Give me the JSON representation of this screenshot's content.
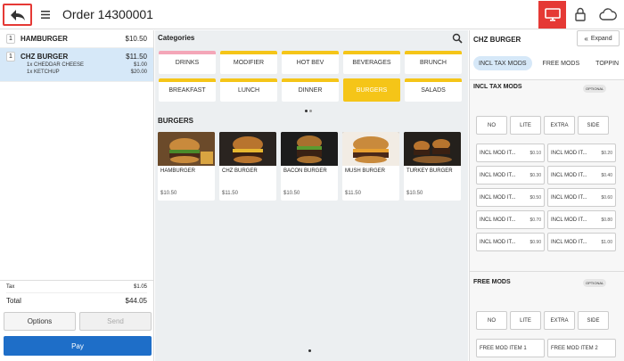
{
  "header": {
    "order_title": "Order 14300001"
  },
  "ticket": {
    "items": [
      {
        "qty": "1",
        "name": "HAMBURGER",
        "price": "$10.50",
        "mods": []
      },
      {
        "qty": "1",
        "name": "CHZ BURGER",
        "price": "$11.50",
        "mods": [
          {
            "name": "1x  CHEDDAR CHEESE",
            "price": "$1.00"
          },
          {
            "name": "1x  KETCHUP",
            "price": "$20.00"
          }
        ]
      }
    ],
    "tax_label": "Tax",
    "tax_value": "$1.05",
    "total_label": "Total",
    "total_value": "$44.05",
    "options_label": "Options",
    "send_label": "Send",
    "pay_label": "Pay"
  },
  "categories": {
    "title": "Categories",
    "items": [
      "DRINKS",
      "MODIFIER",
      "HOT BEV",
      "BEVERAGES",
      "BRUNCH",
      "BREAKFAST",
      "LUNCH",
      "DINNER",
      "BURGERS",
      "SALADS"
    ]
  },
  "menu": {
    "section_title": "BURGERS",
    "items": [
      {
        "name": "HAMBURGER",
        "price": "$10.50"
      },
      {
        "name": "CHZ BURGER",
        "price": "$11.50"
      },
      {
        "name": "BACON BURGER",
        "price": "$10.50"
      },
      {
        "name": "MUSH BURGER",
        "price": "$11.50"
      },
      {
        "name": "TURKEY BURGER",
        "price": "$10.50"
      }
    ]
  },
  "modifiers": {
    "title": "CHZ BURGER",
    "expand_label": "Expand",
    "tabs": [
      "INCL TAX MODS",
      "FREE MODS",
      "TOPPIN"
    ],
    "groups": [
      {
        "title": "INCL TAX MODS",
        "badge": "OPTIONAL",
        "sizes": [
          "NO",
          "LITE",
          "EXTRA",
          "SIDE"
        ],
        "items": [
          {
            "name": "INCL MOD IT...",
            "price": "$0.10"
          },
          {
            "name": "INCL MOD IT...",
            "price": "$0.20"
          },
          {
            "name": "INCL MOD IT...",
            "price": "$0.30"
          },
          {
            "name": "INCL MOD IT...",
            "price": "$0.40"
          },
          {
            "name": "INCL MOD IT...",
            "price": "$0.50"
          },
          {
            "name": "INCL MOD IT...",
            "price": "$0.60"
          },
          {
            "name": "INCL MOD IT...",
            "price": "$0.70"
          },
          {
            "name": "INCL MOD IT...",
            "price": "$0.80"
          },
          {
            "name": "INCL MOD IT...",
            "price": "$0.90"
          },
          {
            "name": "INCL MOD IT...",
            "price": "$1.00"
          }
        ]
      },
      {
        "title": "FREE MODS",
        "badge": "OPTIONAL",
        "sizes": [
          "NO",
          "LITE",
          "EXTRA",
          "SIDE"
        ],
        "items": [
          {
            "name": "FREE MOD ITEM 1",
            "price": ""
          },
          {
            "name": "FREE MOD ITEM 2",
            "price": ""
          }
        ]
      }
    ]
  },
  "colors": {
    "accent_red": "#e53935",
    "category_yellow": "#f5c518",
    "category_pink": "#f4a6b8",
    "pay_blue": "#1e6ec8",
    "selected_blue": "#d6e8f8"
  }
}
